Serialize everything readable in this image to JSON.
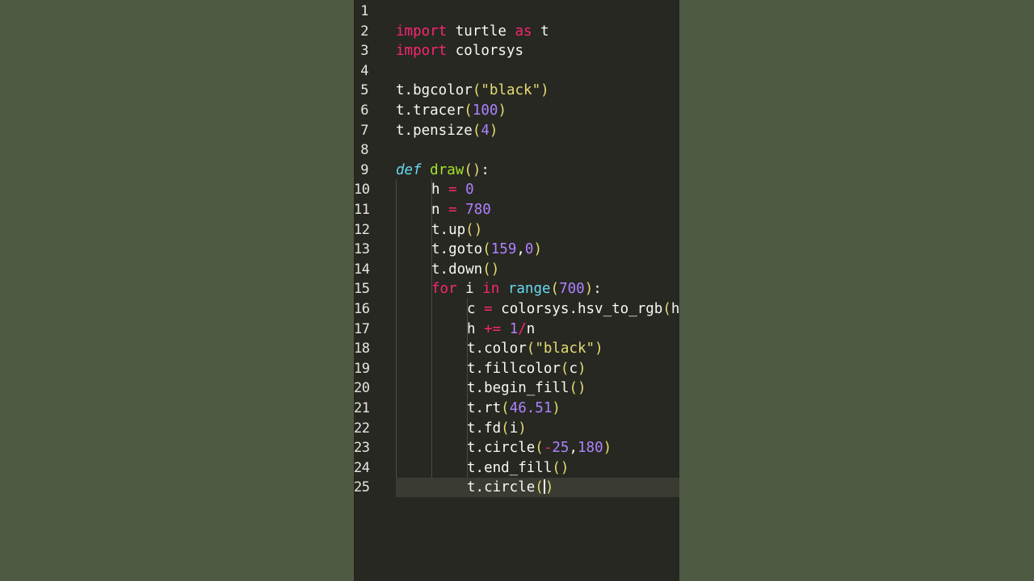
{
  "colors": {
    "background": "#4f5a45",
    "editor_bg": "#272822",
    "keyword": "#f92672",
    "function": "#a6e22e",
    "number": "#ae81ff",
    "string": "#e6db74",
    "builtin": "#66d9ef"
  },
  "editor": {
    "current_line": 25,
    "lines": [
      {
        "n": "1",
        "code": ""
      },
      {
        "n": "2",
        "code": "import turtle as t"
      },
      {
        "n": "3",
        "code": "import colorsys"
      },
      {
        "n": "4",
        "code": ""
      },
      {
        "n": "5",
        "code": "t.bgcolor(\"black\")"
      },
      {
        "n": "6",
        "code": "t.tracer(100)"
      },
      {
        "n": "7",
        "code": "t.pensize(4)"
      },
      {
        "n": "8",
        "code": ""
      },
      {
        "n": "9",
        "code": "def draw():"
      },
      {
        "n": "10",
        "code": "h = 0"
      },
      {
        "n": "11",
        "code": "n = 780"
      },
      {
        "n": "12",
        "code": "t.up()"
      },
      {
        "n": "13",
        "code": "t.goto(159,0)"
      },
      {
        "n": "14",
        "code": "t.down()"
      },
      {
        "n": "15",
        "code": "for i in range(700):"
      },
      {
        "n": "16",
        "code": "c = colorsys.hsv_to_rgb(h"
      },
      {
        "n": "17",
        "code": "h += 1/n"
      },
      {
        "n": "18",
        "code": "t.color(\"black\")"
      },
      {
        "n": "19",
        "code": "t.fillcolor(c)"
      },
      {
        "n": "20",
        "code": "t.begin_fill()"
      },
      {
        "n": "21",
        "code": "t.rt(46.51)"
      },
      {
        "n": "22",
        "code": "t.fd(i)"
      },
      {
        "n": "23",
        "code": "t.circle(-25,180)"
      },
      {
        "n": "24",
        "code": "t.end_fill()"
      },
      {
        "n": "25",
        "code": "t.circle()"
      }
    ]
  }
}
